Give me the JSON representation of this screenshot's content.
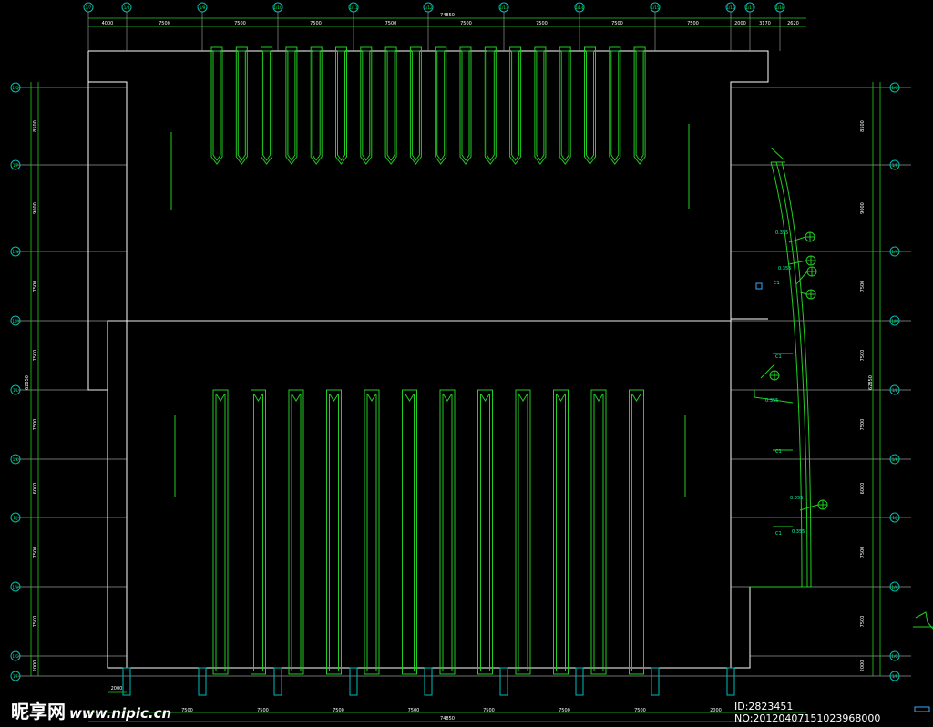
{
  "colors": {
    "background": "#000000",
    "outline": "#ffffff",
    "beams": "#22cc22",
    "grid": "#00bbbb",
    "axis_text": "#00ff66"
  },
  "top_grid": {
    "total": "74850",
    "spans": [
      "4000",
      "7500",
      "7500",
      "7500",
      "7500",
      "7500",
      "7500",
      "7500",
      "7500",
      "2000",
      "3170",
      "2620"
    ],
    "labels": [
      "1/7",
      "1/8",
      "1/9",
      "1/10",
      "1/11",
      "1/12",
      "1/13",
      "1/14",
      "1/15",
      "1/16",
      "1/17",
      "1/18"
    ]
  },
  "bottom_grid": {
    "total": "74850",
    "left_span": "2000",
    "spans": [
      "7500",
      "7500",
      "7500",
      "7500",
      "7500",
      "7500",
      "7500",
      "2000"
    ]
  },
  "left_grid": {
    "labels": [
      "1/Q",
      "1/P",
      "1/N",
      "1/M",
      "1/L",
      "1/K",
      "1/J",
      "1/H",
      "1/G",
      "1/F"
    ],
    "spans": [
      "8500",
      "9000",
      "7500",
      "7500",
      "7500",
      "6000",
      "7500",
      "7500",
      "2000"
    ],
    "total": "62850"
  },
  "right_grid": {
    "labels": [
      "1/Q",
      "1/P",
      "1/N",
      "1/M",
      "1/L",
      "1/K",
      "1/J",
      "1/H",
      "1/G",
      "1/F"
    ],
    "spans": [
      "8500",
      "9000",
      "7500",
      "7500",
      "7500",
      "6000",
      "7500",
      "7500",
      "2000"
    ],
    "total": "62850"
  },
  "annotations": {
    "curve_tags": [
      "0.355",
      "0.355",
      "C1",
      "C1",
      "0.355",
      "0.355",
      "C1",
      "C1",
      "0.355"
    ]
  },
  "watermark": {
    "site": "昵享网",
    "url": "www.nipic.cn",
    "id": "ID:2823451 NO:20120407151023968000"
  }
}
